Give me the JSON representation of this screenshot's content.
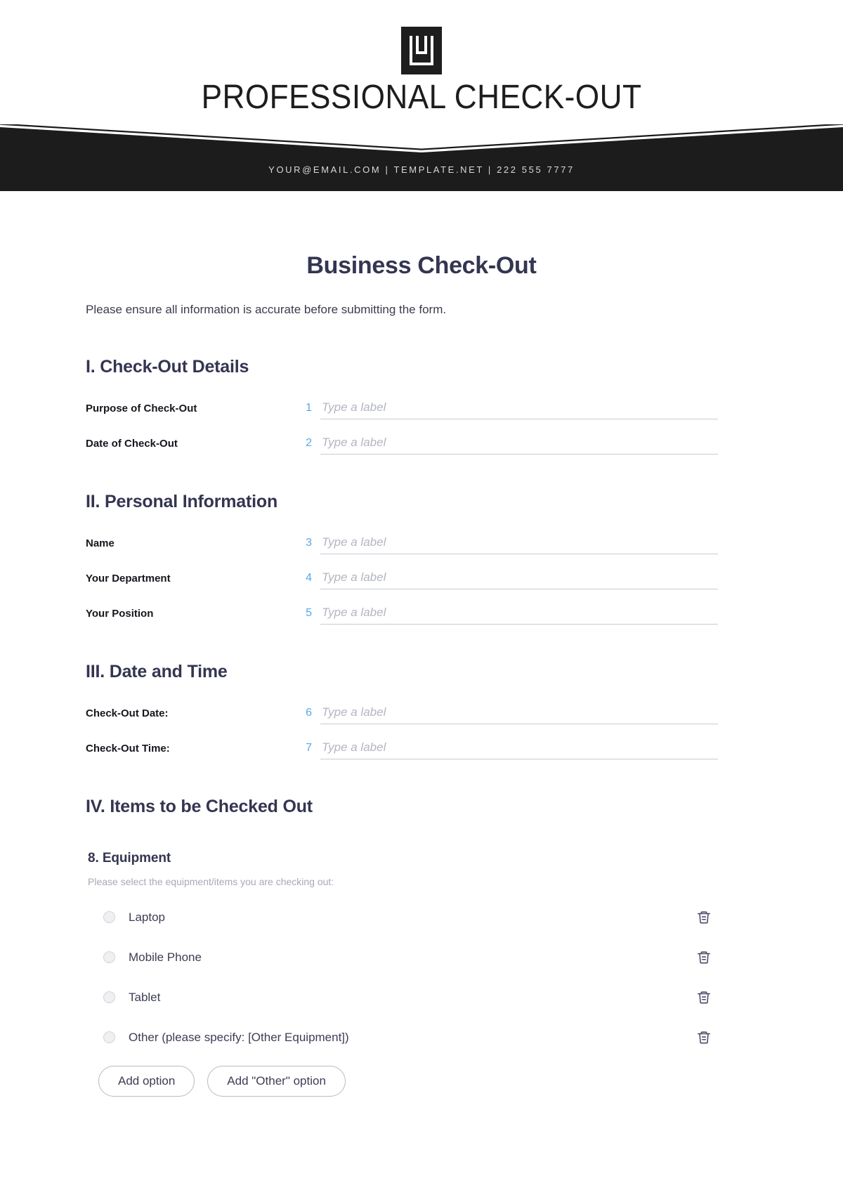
{
  "header": {
    "logo_icon": "nested-square-logo-icon",
    "brand_title": "PROFESSIONAL CHECK-OUT",
    "contact_bar": "YOUR@EMAIL.COM | TEMPLATE.NET | 222 555 7777",
    "band_color": "#1c1c1c"
  },
  "document": {
    "title": "Business Check-Out",
    "intro": "Please ensure all information is accurate before submitting the form.",
    "title_color": "#343551",
    "accent_number_color": "#56a9e8",
    "placeholder": "Type a label"
  },
  "sections": [
    {
      "heading": "I. Check-Out Details",
      "fields": [
        {
          "number": "1",
          "label": "Purpose of Check-Out",
          "value": "Type a label"
        },
        {
          "number": "2",
          "label": "Date of Check-Out",
          "value": "Type a label"
        }
      ]
    },
    {
      "heading": "II. Personal Information",
      "fields": [
        {
          "number": "3",
          "label": "Name",
          "value": "Type a label"
        },
        {
          "number": "4",
          "label": "Your Department",
          "value": "Type a label"
        },
        {
          "number": "5",
          "label": "Your Position",
          "value": "Type a label"
        }
      ]
    },
    {
      "heading": "III. Date and Time",
      "fields": [
        {
          "number": "6",
          "label": "Check-Out Date:",
          "value": "Type a label"
        },
        {
          "number": "7",
          "label": "Check-Out Time:",
          "value": "Type a label"
        }
      ]
    },
    {
      "heading": "IV. Items to be Checked Out",
      "sub_heading": "8. Equipment",
      "sub_note": "Please select the equipment/items you are checking out:",
      "options": [
        {
          "label": "Laptop",
          "delete_icon": "trash-icon"
        },
        {
          "label": "Mobile Phone",
          "delete_icon": "trash-icon"
        },
        {
          "label": "Tablet",
          "delete_icon": "trash-icon"
        },
        {
          "label": "Other (please specify: [Other Equipment])",
          "delete_icon": "trash-icon"
        }
      ],
      "buttons": [
        {
          "label": "Add option"
        },
        {
          "label": "Add \"Other\" option"
        }
      ]
    }
  ]
}
